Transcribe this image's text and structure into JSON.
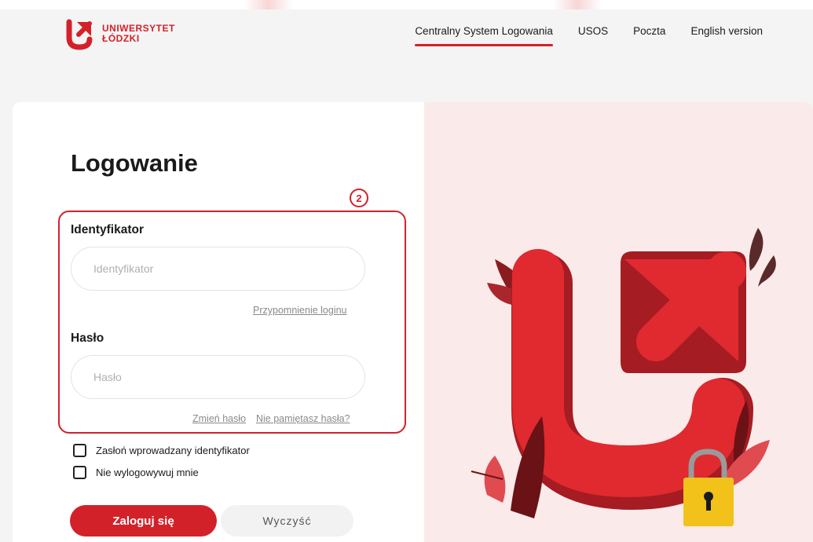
{
  "header": {
    "logo_line1": "UNIWERSYTET",
    "logo_line2": "ŁÓDZKI",
    "nav": [
      {
        "label": "Centralny System Logowania",
        "active": true
      },
      {
        "label": "USOS"
      },
      {
        "label": "Poczta"
      },
      {
        "label": "English version"
      }
    ]
  },
  "form": {
    "title": "Logowanie",
    "callout_number": "2",
    "id_label": "Identyfikator",
    "id_placeholder": "Identyfikator",
    "remind_login": "Przypomnienie loginu",
    "password_label": "Hasło",
    "password_placeholder": "Hasło",
    "change_password": "Zmień hasło",
    "forgot_password": "Nie pamiętasz hasła?",
    "mask_id": "Zasłoń wprowadzany identyfikator",
    "stay_logged": "Nie wylogowywuj mnie",
    "login_button": "Zaloguj się",
    "clear_button": "Wyczyść"
  },
  "colors": {
    "brand_red": "#d3212a",
    "art_bg": "#fbeaea",
    "lock_yellow": "#f2c21b"
  }
}
